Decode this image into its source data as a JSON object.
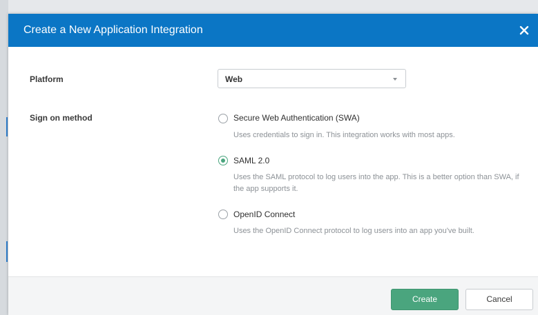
{
  "modal": {
    "title": "Create a New Application Integration",
    "close_icon": "close-icon"
  },
  "platform": {
    "label": "Platform",
    "selected": "Web"
  },
  "sign_on": {
    "label": "Sign on method",
    "selected": "SAML 2.0",
    "options": [
      {
        "label": "Secure Web Authentication (SWA)",
        "description": "Uses credentials to sign in. This integration works with most apps.",
        "checked": false
      },
      {
        "label": "SAML 2.0",
        "description": "Uses the SAML protocol to log users into the app. This is a better option than SWA, if the app supports it.",
        "checked": true
      },
      {
        "label": "OpenID Connect",
        "description": "Uses the OpenID Connect protocol to log users into an app you've built.",
        "checked": false
      }
    ]
  },
  "footer": {
    "create_label": "Create",
    "cancel_label": "Cancel"
  },
  "colors": {
    "header": "#0b76c5",
    "accent": "#4aa57e"
  }
}
